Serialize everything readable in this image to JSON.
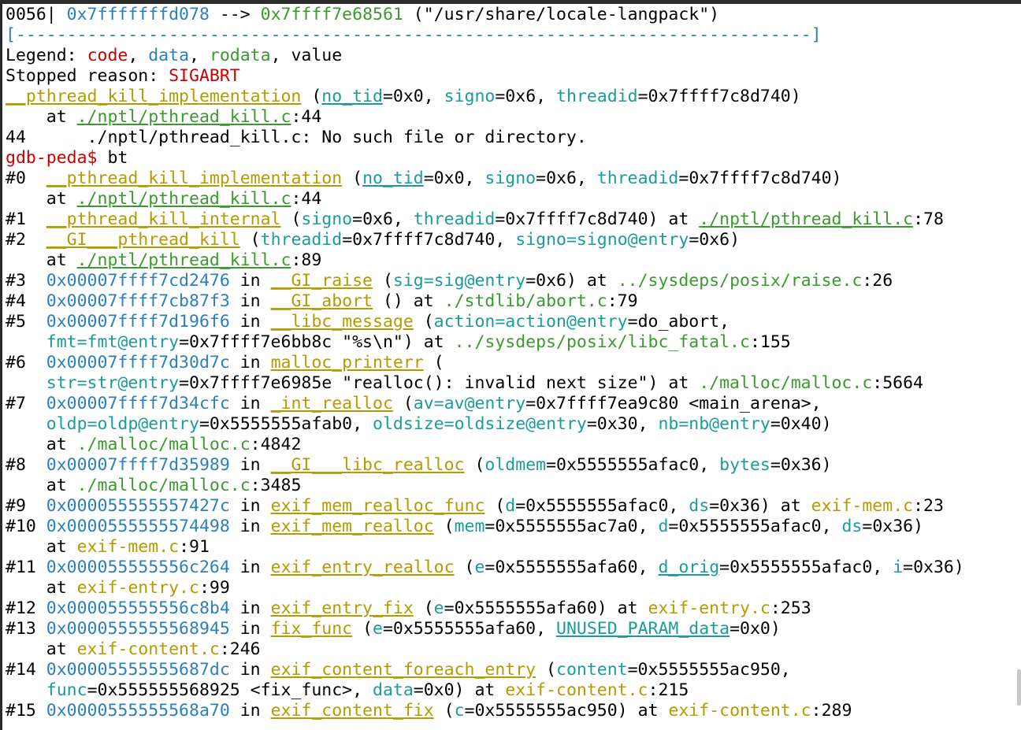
{
  "colors": {
    "background": "#ffffff",
    "text": "#000000",
    "address": "#2a7fbd",
    "function": "#b59a00",
    "parameter": "#1a9c9c",
    "file": "#3a9a2e",
    "alert": "#cc0000"
  },
  "terminal": {
    "lines": [
      [
        {
          "t": "0056| ",
          "c": "plain"
        },
        {
          "t": "0x7fffffffd078",
          "c": "addr"
        },
        {
          "t": " --> ",
          "c": "plain"
        },
        {
          "t": "0x7ffff7e68561",
          "c": "file"
        },
        {
          "t": " (\"/usr/share/locale-langpack\")",
          "c": "plain"
        }
      ],
      [
        {
          "t": "[------------------------------------------------------------------------------]",
          "c": "rule"
        }
      ],
      [
        {
          "t": "Legend: ",
          "c": "plain"
        },
        {
          "t": "code",
          "c": "red"
        },
        {
          "t": ", ",
          "c": "plain"
        },
        {
          "t": "data",
          "c": "addr"
        },
        {
          "t": ", ",
          "c": "plain"
        },
        {
          "t": "rodata",
          "c": "file"
        },
        {
          "t": ", value",
          "c": "plain"
        }
      ],
      [
        {
          "t": "Stopped reason: ",
          "c": "plain"
        },
        {
          "t": "SIGABRT",
          "c": "red"
        }
      ],
      [
        {
          "t": "__pthread_kill_implementation",
          "c": "func",
          "u": true
        },
        {
          "t": " (",
          "c": "plain"
        },
        {
          "t": "no_tid",
          "c": "param",
          "u": true
        },
        {
          "t": "=0x0, ",
          "c": "plain"
        },
        {
          "t": "signo",
          "c": "param"
        },
        {
          "t": "=0x6, ",
          "c": "plain"
        },
        {
          "t": "threadid",
          "c": "param"
        },
        {
          "t": "=0x7ffff7c8d740)",
          "c": "plain"
        }
      ],
      [
        {
          "t": "    at ",
          "c": "plain"
        },
        {
          "t": "./nptl/pthread_kill.c",
          "c": "file",
          "u": true
        },
        {
          "t": ":44",
          "c": "plain"
        }
      ],
      [
        {
          "t": "44      ./nptl/pthread_kill.c: No such file or directory.",
          "c": "plain"
        }
      ],
      [
        {
          "t": "gdb-peda$ ",
          "c": "red"
        },
        {
          "t": "bt",
          "c": "plain"
        }
      ],
      [
        {
          "t": "#0  ",
          "c": "plain"
        },
        {
          "t": "__pthread_kill_implementation",
          "c": "func",
          "u": true
        },
        {
          "t": " (",
          "c": "plain"
        },
        {
          "t": "no_tid",
          "c": "param",
          "u": true
        },
        {
          "t": "=0x0, ",
          "c": "plain"
        },
        {
          "t": "signo",
          "c": "param"
        },
        {
          "t": "=0x6, ",
          "c": "plain"
        },
        {
          "t": "threadid",
          "c": "param"
        },
        {
          "t": "=0x7ffff7c8d740)",
          "c": "plain"
        }
      ],
      [
        {
          "t": "    at ",
          "c": "plain"
        },
        {
          "t": "./nptl/pthread_kill.c",
          "c": "file",
          "u": true
        },
        {
          "t": ":44",
          "c": "plain"
        }
      ],
      [
        {
          "t": "#1  ",
          "c": "plain"
        },
        {
          "t": "__pthread_kill_internal",
          "c": "func",
          "u": true
        },
        {
          "t": " (",
          "c": "plain"
        },
        {
          "t": "signo",
          "c": "param"
        },
        {
          "t": "=0x6, ",
          "c": "plain"
        },
        {
          "t": "threadid",
          "c": "param"
        },
        {
          "t": "=0x7ffff7c8d740) at ",
          "c": "plain"
        },
        {
          "t": "./nptl/pthread_kill.c",
          "c": "file",
          "u": true
        },
        {
          "t": ":78",
          "c": "plain"
        }
      ],
      [
        {
          "t": "#2  ",
          "c": "plain"
        },
        {
          "t": "__GI___pthread_kill",
          "c": "func",
          "u": true
        },
        {
          "t": " (",
          "c": "plain"
        },
        {
          "t": "threadid",
          "c": "param"
        },
        {
          "t": "=0x7ffff7c8d740, ",
          "c": "plain"
        },
        {
          "t": "signo=signo@entry",
          "c": "param"
        },
        {
          "t": "=0x6)",
          "c": "plain"
        }
      ],
      [
        {
          "t": "    at ",
          "c": "plain"
        },
        {
          "t": "./nptl/pthread_kill.c",
          "c": "file",
          "u": true
        },
        {
          "t": ":89",
          "c": "plain"
        }
      ],
      [
        {
          "t": "#3  ",
          "c": "plain"
        },
        {
          "t": "0x00007ffff7cd2476",
          "c": "addr"
        },
        {
          "t": " in ",
          "c": "plain"
        },
        {
          "t": "__GI_raise",
          "c": "func",
          "u": true
        },
        {
          "t": " (",
          "c": "plain"
        },
        {
          "t": "sig=sig@entry",
          "c": "param"
        },
        {
          "t": "=0x6) at ",
          "c": "plain"
        },
        {
          "t": "../sysdeps/posix/raise.c",
          "c": "file"
        },
        {
          "t": ":26",
          "c": "plain"
        }
      ],
      [
        {
          "t": "#4  ",
          "c": "plain"
        },
        {
          "t": "0x00007ffff7cb87f3",
          "c": "addr"
        },
        {
          "t": " in ",
          "c": "plain"
        },
        {
          "t": "__GI_abort",
          "c": "func",
          "u": true
        },
        {
          "t": " () at ",
          "c": "plain"
        },
        {
          "t": "./stdlib/abort.c",
          "c": "file"
        },
        {
          "t": ":79",
          "c": "plain"
        }
      ],
      [
        {
          "t": "#5  ",
          "c": "plain"
        },
        {
          "t": "0x00007ffff7d196f6",
          "c": "addr"
        },
        {
          "t": " in ",
          "c": "plain"
        },
        {
          "t": "__libc_message",
          "c": "func",
          "u": true
        },
        {
          "t": " (",
          "c": "plain"
        },
        {
          "t": "action=action@entry",
          "c": "param"
        },
        {
          "t": "=do_abort,",
          "c": "plain"
        }
      ],
      [
        {
          "t": "    ",
          "c": "plain"
        },
        {
          "t": "fmt=fmt@entry",
          "c": "param"
        },
        {
          "t": "=0x7ffff7e6bb8c \"%s\\n\") at ",
          "c": "plain"
        },
        {
          "t": "../sysdeps/posix/libc_fatal.c",
          "c": "file"
        },
        {
          "t": ":155",
          "c": "plain"
        }
      ],
      [
        {
          "t": "#6  ",
          "c": "plain"
        },
        {
          "t": "0x00007ffff7d30d7c",
          "c": "addr"
        },
        {
          "t": " in ",
          "c": "plain"
        },
        {
          "t": "malloc_printerr",
          "c": "func",
          "u": true
        },
        {
          "t": " (",
          "c": "plain"
        }
      ],
      [
        {
          "t": "    ",
          "c": "plain"
        },
        {
          "t": "str=str@entry",
          "c": "param"
        },
        {
          "t": "=0x7ffff7e6985e \"realloc(): invalid next size\") at ",
          "c": "plain"
        },
        {
          "t": "./malloc/malloc.c",
          "c": "file"
        },
        {
          "t": ":5664",
          "c": "plain"
        }
      ],
      [
        {
          "t": "#7  ",
          "c": "plain"
        },
        {
          "t": "0x00007ffff7d34cfc",
          "c": "addr"
        },
        {
          "t": " in ",
          "c": "plain"
        },
        {
          "t": "_int_realloc",
          "c": "func",
          "u": true
        },
        {
          "t": " (",
          "c": "plain"
        },
        {
          "t": "av=av@entry",
          "c": "param"
        },
        {
          "t": "=0x7ffff7ea9c80 <main_arena>,",
          "c": "plain"
        }
      ],
      [
        {
          "t": "    ",
          "c": "plain"
        },
        {
          "t": "oldp=oldp@entry",
          "c": "param"
        },
        {
          "t": "=0x5555555afab0, ",
          "c": "plain"
        },
        {
          "t": "oldsize=oldsize@entry",
          "c": "param"
        },
        {
          "t": "=0x30, ",
          "c": "plain"
        },
        {
          "t": "nb=nb@entry",
          "c": "param"
        },
        {
          "t": "=0x40)",
          "c": "plain"
        }
      ],
      [
        {
          "t": "    at ",
          "c": "plain"
        },
        {
          "t": "./malloc/malloc.c",
          "c": "file"
        },
        {
          "t": ":4842",
          "c": "plain"
        }
      ],
      [
        {
          "t": "#8  ",
          "c": "plain"
        },
        {
          "t": "0x00007ffff7d35989",
          "c": "addr"
        },
        {
          "t": " in ",
          "c": "plain"
        },
        {
          "t": "__GI___libc_realloc",
          "c": "func",
          "u": true
        },
        {
          "t": " (",
          "c": "plain"
        },
        {
          "t": "oldmem",
          "c": "param"
        },
        {
          "t": "=0x5555555afac0, ",
          "c": "plain"
        },
        {
          "t": "bytes",
          "c": "param"
        },
        {
          "t": "=0x36)",
          "c": "plain"
        }
      ],
      [
        {
          "t": "    at ",
          "c": "plain"
        },
        {
          "t": "./malloc/malloc.c",
          "c": "file"
        },
        {
          "t": ":3485",
          "c": "plain"
        }
      ],
      [
        {
          "t": "#9  ",
          "c": "plain"
        },
        {
          "t": "0x000055555557427c",
          "c": "addr"
        },
        {
          "t": " in ",
          "c": "plain"
        },
        {
          "t": "exif_mem_realloc_func",
          "c": "func",
          "u": true
        },
        {
          "t": " (",
          "c": "plain"
        },
        {
          "t": "d",
          "c": "param"
        },
        {
          "t": "=0x5555555afac0, ",
          "c": "plain"
        },
        {
          "t": "ds",
          "c": "param"
        },
        {
          "t": "=0x36) at ",
          "c": "plain"
        },
        {
          "t": "exif-mem.c",
          "c": "func"
        },
        {
          "t": ":23",
          "c": "plain"
        }
      ],
      [
        {
          "t": "#10 ",
          "c": "plain"
        },
        {
          "t": "0x0000555555574498",
          "c": "addr"
        },
        {
          "t": " in ",
          "c": "plain"
        },
        {
          "t": "exif_mem_realloc",
          "c": "func",
          "u": true
        },
        {
          "t": " (",
          "c": "plain"
        },
        {
          "t": "mem",
          "c": "param"
        },
        {
          "t": "=0x5555555ac7a0, ",
          "c": "plain"
        },
        {
          "t": "d",
          "c": "param"
        },
        {
          "t": "=0x5555555afac0, ",
          "c": "plain"
        },
        {
          "t": "ds",
          "c": "param"
        },
        {
          "t": "=0x36)",
          "c": "plain"
        }
      ],
      [
        {
          "t": "    at ",
          "c": "plain"
        },
        {
          "t": "exif-mem.c",
          "c": "func"
        },
        {
          "t": ":91",
          "c": "plain"
        }
      ],
      [
        {
          "t": "#11 ",
          "c": "plain"
        },
        {
          "t": "0x000055555556c264",
          "c": "addr"
        },
        {
          "t": " in ",
          "c": "plain"
        },
        {
          "t": "exif_entry_realloc",
          "c": "func",
          "u": true
        },
        {
          "t": " (",
          "c": "plain"
        },
        {
          "t": "e",
          "c": "param"
        },
        {
          "t": "=0x5555555afa60, ",
          "c": "plain"
        },
        {
          "t": "d_orig",
          "c": "param",
          "u": true
        },
        {
          "t": "=0x5555555afac0, ",
          "c": "plain"
        },
        {
          "t": "i",
          "c": "param"
        },
        {
          "t": "=0x36)",
          "c": "plain"
        }
      ],
      [
        {
          "t": "    at ",
          "c": "plain"
        },
        {
          "t": "exif-entry.c",
          "c": "func"
        },
        {
          "t": ":99",
          "c": "plain"
        }
      ],
      [
        {
          "t": "#12 ",
          "c": "plain"
        },
        {
          "t": "0x000055555556c8b4",
          "c": "addr"
        },
        {
          "t": " in ",
          "c": "plain"
        },
        {
          "t": "exif_entry_fix",
          "c": "func",
          "u": true
        },
        {
          "t": " (",
          "c": "plain"
        },
        {
          "t": "e",
          "c": "param"
        },
        {
          "t": "=0x5555555afa60) at ",
          "c": "plain"
        },
        {
          "t": "exif-entry.c",
          "c": "func"
        },
        {
          "t": ":253",
          "c": "plain"
        }
      ],
      [
        {
          "t": "#13 ",
          "c": "plain"
        },
        {
          "t": "0x0000555555568945",
          "c": "addr"
        },
        {
          "t": " in ",
          "c": "plain"
        },
        {
          "t": "fix_func",
          "c": "func",
          "u": true
        },
        {
          "t": " (",
          "c": "plain"
        },
        {
          "t": "e",
          "c": "param"
        },
        {
          "t": "=0x5555555afa60, ",
          "c": "plain"
        },
        {
          "t": "UNUSED_PARAM_data",
          "c": "param",
          "u": true
        },
        {
          "t": "=0x0)",
          "c": "plain"
        }
      ],
      [
        {
          "t": "    at ",
          "c": "plain"
        },
        {
          "t": "exif-content.c",
          "c": "func"
        },
        {
          "t": ":246",
          "c": "plain"
        }
      ],
      [
        {
          "t": "#14 ",
          "c": "plain"
        },
        {
          "t": "0x00005555555687dc",
          "c": "addr"
        },
        {
          "t": " in ",
          "c": "plain"
        },
        {
          "t": "exif_content_foreach_entry",
          "c": "func",
          "u": true
        },
        {
          "t": " (",
          "c": "plain"
        },
        {
          "t": "content",
          "c": "param"
        },
        {
          "t": "=0x5555555ac950,",
          "c": "plain"
        }
      ],
      [
        {
          "t": "    ",
          "c": "plain"
        },
        {
          "t": "func",
          "c": "param"
        },
        {
          "t": "=0x555555568925 <fix_func>, ",
          "c": "plain"
        },
        {
          "t": "data",
          "c": "param"
        },
        {
          "t": "=0x0) at ",
          "c": "plain"
        },
        {
          "t": "exif-content.c",
          "c": "func"
        },
        {
          "t": ":215",
          "c": "plain"
        }
      ],
      [
        {
          "t": "#15 ",
          "c": "plain"
        },
        {
          "t": "0x0000555555568a70",
          "c": "addr"
        },
        {
          "t": " in ",
          "c": "plain"
        },
        {
          "t": "exif_content_fix",
          "c": "func",
          "u": true
        },
        {
          "t": " (",
          "c": "plain"
        },
        {
          "t": "c",
          "c": "param"
        },
        {
          "t": "=0x5555555ac950) at ",
          "c": "plain"
        },
        {
          "t": "exif-content.c",
          "c": "func"
        },
        {
          "t": ":289",
          "c": "plain"
        }
      ]
    ]
  }
}
